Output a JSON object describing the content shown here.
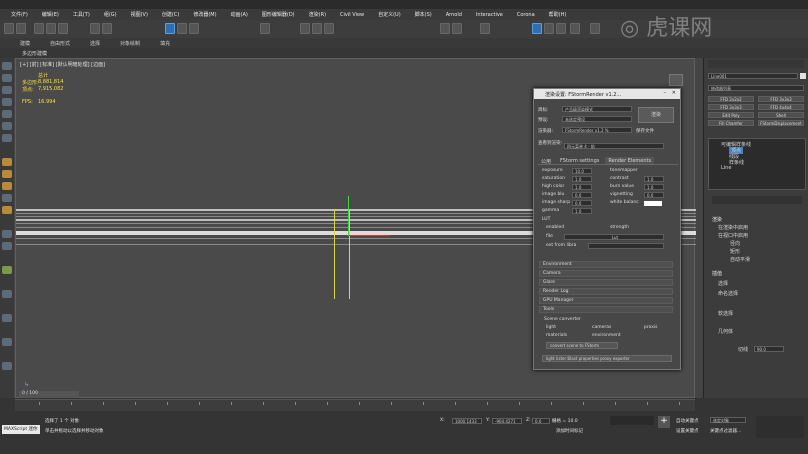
{
  "menubar": {
    "items": [
      "文件(F)",
      "编辑(E)",
      "工具(T)",
      "组(G)",
      "视图(V)",
      "创建(C)",
      "修改器(M)",
      "动画(A)",
      "图形编辑器(D)",
      "渲染(R)",
      "Civil View",
      "自定义(U)",
      "脚本(S)",
      "Arnold",
      "Interactive",
      "Corona",
      "帮助(H)"
    ]
  },
  "ribbon": {
    "tabs": [
      "建模",
      "自由形式",
      "选择",
      "对象绘制",
      "填充"
    ],
    "sub_label": "多边形建模"
  },
  "viewport": {
    "label": "[+] [前] [标准] [默认明暗处理] [边面]",
    "stats_total": "总计",
    "stats_polys_label": "多边形:",
    "stats_polys": "8,881,814",
    "stats_verts_label": "顶点:",
    "stats_verts": "7,915,082",
    "fps_label": "FPS:",
    "fps": "16.994"
  },
  "dialog": {
    "title": "渲染设置: FStormRender v1.2...",
    "target_label": "目标:",
    "target_value": "产品级渲染模式",
    "preset_label": "预设:",
    "preset_value": "未选定预设",
    "renderer_label": "渲染器:",
    "renderer_value": "FStormRender v1.2 %",
    "save_file": "保存文件",
    "render_button": "渲染",
    "view_label": "查看到渲染:",
    "view_value": "四元菜单 4 - 前",
    "tabs": [
      "公用",
      "FStorm settings",
      "Render Elements"
    ],
    "params": [
      [
        "exposure",
        "10.0",
        "tonemapper",
        ""
      ],
      [
        "saturation",
        "1.0",
        "contrast",
        "1.0"
      ],
      [
        "high color",
        "1.0",
        "burn value",
        "1.0"
      ],
      [
        "image blu",
        "0.0",
        "vignetting",
        "0.0"
      ],
      [
        "image sharp",
        "0.0",
        "white balanc",
        ""
      ],
      [
        "gamma",
        "1.0",
        "",
        ""
      ]
    ],
    "lut_label": "LUT",
    "lut_enabled": "enabled",
    "lut_strength": "strength",
    "lut_file": "file",
    "lut_none": "Lut",
    "lut_ext": "ext from libra",
    "rollouts": [
      "Environment",
      "Camera",
      "Glare",
      "Render Log",
      "GPU Manager",
      "Tools"
    ],
    "tools_scene_converter": "Scene converter",
    "tools_light": "light",
    "tools_camera": "cameras",
    "tools_proxis": "proxis",
    "tools_materials": "materials",
    "tools_environment": "environment",
    "tools_convert": "convert scene to FStorm",
    "tools_lister": "light lister  Blast properties  proxy exporter"
  },
  "rightpanel": {
    "object_name": "Line001",
    "modifier_list": "修改器列表",
    "buttons": [
      "FFD 2x2x2",
      "FFD 3x3x3",
      "FFD 3x3x3",
      "FFD 4x4x4",
      "Edit Poly",
      "Shell",
      "Fill Chamfer",
      "FStormDisplacement"
    ],
    "stack": [
      "可编辑样条线",
      "顶点",
      "线段",
      "样条线",
      "Line"
    ],
    "rollout_render": "渲染",
    "in_renderer": "在渲染中启用",
    "in_viewport": "在视口中启用",
    "radial": "径向",
    "rectangular": "矩形",
    "auto_smooth": "自动平滑",
    "rollout_interp": "插值",
    "selection": "选择",
    "named_sel": "命名选择",
    "soft_sel": "软选择",
    "geometry": "几何体",
    "cut_label": "切线",
    "cut_value": "90.0"
  },
  "status": {
    "frame": "0 / 100",
    "selection": "选择了 1 个 对象",
    "hint": "单击并拖动以选择并移动对象",
    "x_label": "X:",
    "x_value": "1000.1433",
    "y_label": "Y:",
    "y_value": "-904.4271",
    "z_label": "Z:",
    "z_value": "0.0",
    "grid": "栅格 = 10.0",
    "add_time_tag": "添加时间标记",
    "auto_key": "自动关键点",
    "set_key": "设置关键点",
    "filter": "关键点过滤器...",
    "selected": "选定对象",
    "maxscript": "MAXScript 迷你"
  },
  "watermark": "虎课网"
}
